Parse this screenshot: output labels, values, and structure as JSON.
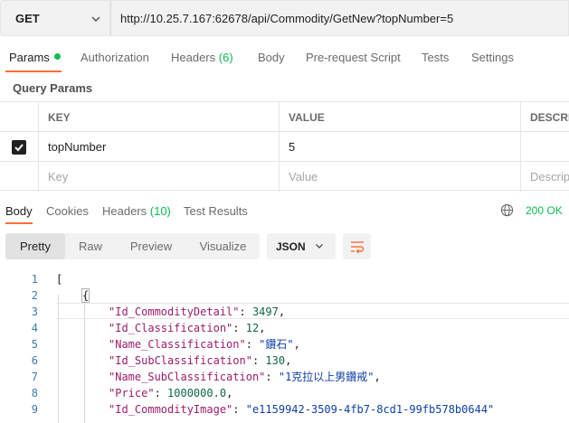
{
  "request": {
    "method": "GET",
    "url": "http://10.25.7.167:62678/api/Commodity/GetNew?topNumber=5"
  },
  "request_tabs": {
    "params": "Params",
    "authorization": "Authorization",
    "headers": "Headers",
    "headers_count": "(6)",
    "body": "Body",
    "pre_request_script": "Pre-request Script",
    "tests": "Tests",
    "settings": "Settings"
  },
  "query_params": {
    "title": "Query Params",
    "columns": [
      "KEY",
      "VALUE",
      "DESCRI"
    ],
    "rows": [
      {
        "key": "topNumber",
        "value": "5",
        "checked": true
      }
    ],
    "placeholder": {
      "key": "Key",
      "value": "Value",
      "description": "Descrip"
    }
  },
  "response_tabs": {
    "body": "Body",
    "cookies": "Cookies",
    "headers": "Headers",
    "headers_count": "(10)",
    "test_results": "Test Results",
    "status": "200 OK"
  },
  "toolbar": {
    "modes": [
      "Pretty",
      "Raw",
      "Preview",
      "Visualize"
    ],
    "active_mode": "Pretty",
    "format": "JSON"
  },
  "code": {
    "line_numbers": [
      "1",
      "2",
      "3",
      "4",
      "5",
      "6",
      "7",
      "8",
      "9"
    ],
    "line1": "[",
    "line2": "{",
    "k3": "\"Id_CommodityDetail\"",
    "v3": "3497",
    "k4": "\"Id_Classification\"",
    "v4": "12",
    "k5": "\"Name_Classification\"",
    "v5": "\"鑽石\"",
    "k6": "\"Id_SubClassification\"",
    "v6": "130",
    "k7": "\"Name_SubClassification\"",
    "v7": "\"1克拉以上男鑽戒\"",
    "k8": "\"Price\"",
    "v8": "1000000.0",
    "k9": "\"Id_CommodityImage\"",
    "v9": "\"e1159942-3509-4fb7-8cd1-99fb578b0644\""
  },
  "colors": {
    "accent": "#ff6c37",
    "success": "#0cbb52",
    "json_key": "#9c1c6c",
    "json_string": "#0e3fa6",
    "json_number": "#116644"
  }
}
